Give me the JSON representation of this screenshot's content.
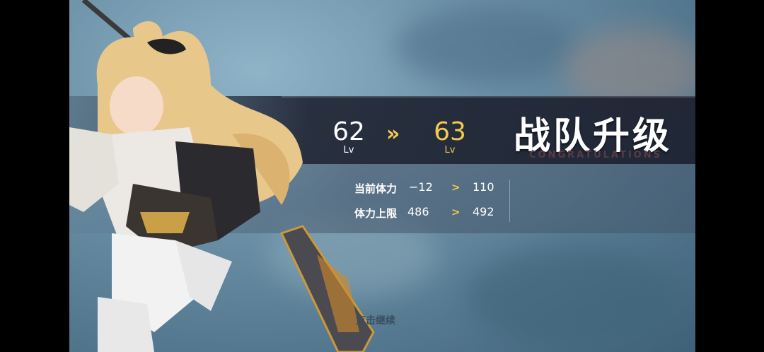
{
  "header": {
    "title": "战队升级",
    "subtitle": "CONGRATULATIONS"
  },
  "level": {
    "from": "62",
    "to": "63",
    "unit": "Lv",
    "arrow": "»"
  },
  "stats": [
    {
      "label": "当前体力",
      "from": "−12",
      "to": "110"
    },
    {
      "label": "体力上限",
      "from": "486",
      "to": "492"
    }
  ],
  "stat_arrow": ">",
  "footer": {
    "hint": "点击继续"
  },
  "colors": {
    "accent": "#f2cb4e",
    "band": "#1c202e",
    "subtitle": "#5a3a46"
  }
}
